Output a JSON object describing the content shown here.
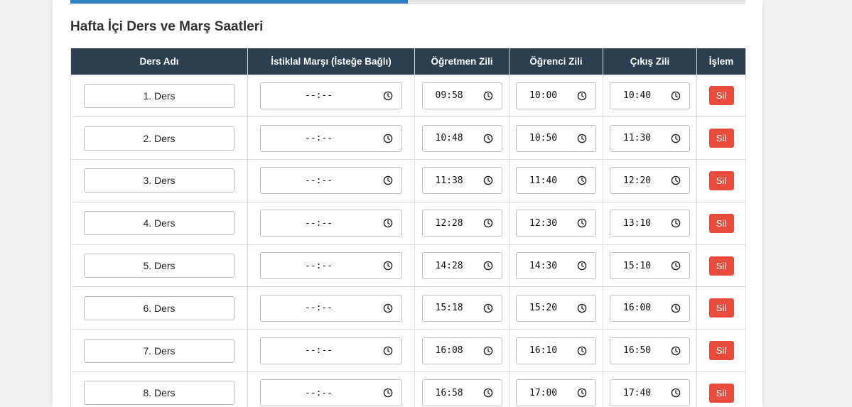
{
  "section_title": "Hafta İçi Ders ve Marş Saatleri",
  "colors": {
    "header_bg": "#2c3e50",
    "delete_bg": "#e74c3c",
    "tab_active": "#2f7fc4"
  },
  "table": {
    "headers": [
      "Ders Adı",
      "İstiklal Marşı (İsteğe Bağlı)",
      "Öğretmen Zili",
      "Öğrenci Zili",
      "Çıkış Zili",
      "İşlem"
    ],
    "delete_label": "Sil",
    "empty_time": "--:--",
    "rows": [
      {
        "name": "1. Ders",
        "marsh": "--:--",
        "teacher": "09:58",
        "student": "10:00",
        "exit": "10:40"
      },
      {
        "name": "2. Ders",
        "marsh": "--:--",
        "teacher": "10:48",
        "student": "10:50",
        "exit": "11:30"
      },
      {
        "name": "3. Ders",
        "marsh": "--:--",
        "teacher": "11:38",
        "student": "11:40",
        "exit": "12:20"
      },
      {
        "name": "4. Ders",
        "marsh": "--:--",
        "teacher": "12:28",
        "student": "12:30",
        "exit": "13:10"
      },
      {
        "name": "5. Ders",
        "marsh": "--:--",
        "teacher": "14:28",
        "student": "14:30",
        "exit": "15:10"
      },
      {
        "name": "6. Ders",
        "marsh": "--:--",
        "teacher": "15:18",
        "student": "15:20",
        "exit": "16:00"
      },
      {
        "name": "7. Ders",
        "marsh": "--:--",
        "teacher": "16:08",
        "student": "16:10",
        "exit": "16:50"
      },
      {
        "name": "8. Ders",
        "marsh": "--:--",
        "teacher": "16:58",
        "student": "17:00",
        "exit": "17:40"
      }
    ]
  }
}
